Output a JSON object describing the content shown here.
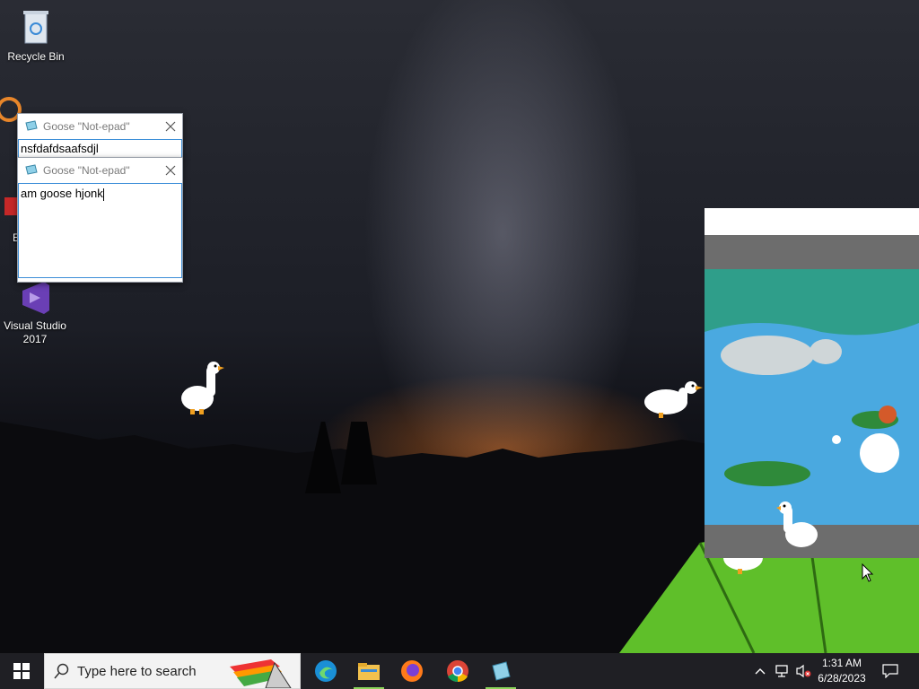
{
  "desktop": {
    "icons": [
      {
        "label": "Recycle Bin"
      },
      {
        "label": "E"
      },
      {
        "label": "Em D"
      },
      {
        "label": "Visual Studio 2017"
      }
    ]
  },
  "notepad1": {
    "title": "Goose \"Not-epad\"",
    "text": "nsfdafdsaafsdjl"
  },
  "notepad2": {
    "title": "Goose \"Not-epad\"",
    "text": "am goose hjonk"
  },
  "taskbar": {
    "search_placeholder": "Type here to search",
    "time": "1:31 AM",
    "date": "6/28/2023",
    "apps": [
      "edge-icon",
      "file-explorer-icon",
      "firefox-icon",
      "chrome-icon",
      "notepad-icon"
    ]
  },
  "colors": {
    "accent": "#3d8fd8",
    "taskbar": "#1f1f24",
    "running_indicator": "#8bd35a"
  }
}
